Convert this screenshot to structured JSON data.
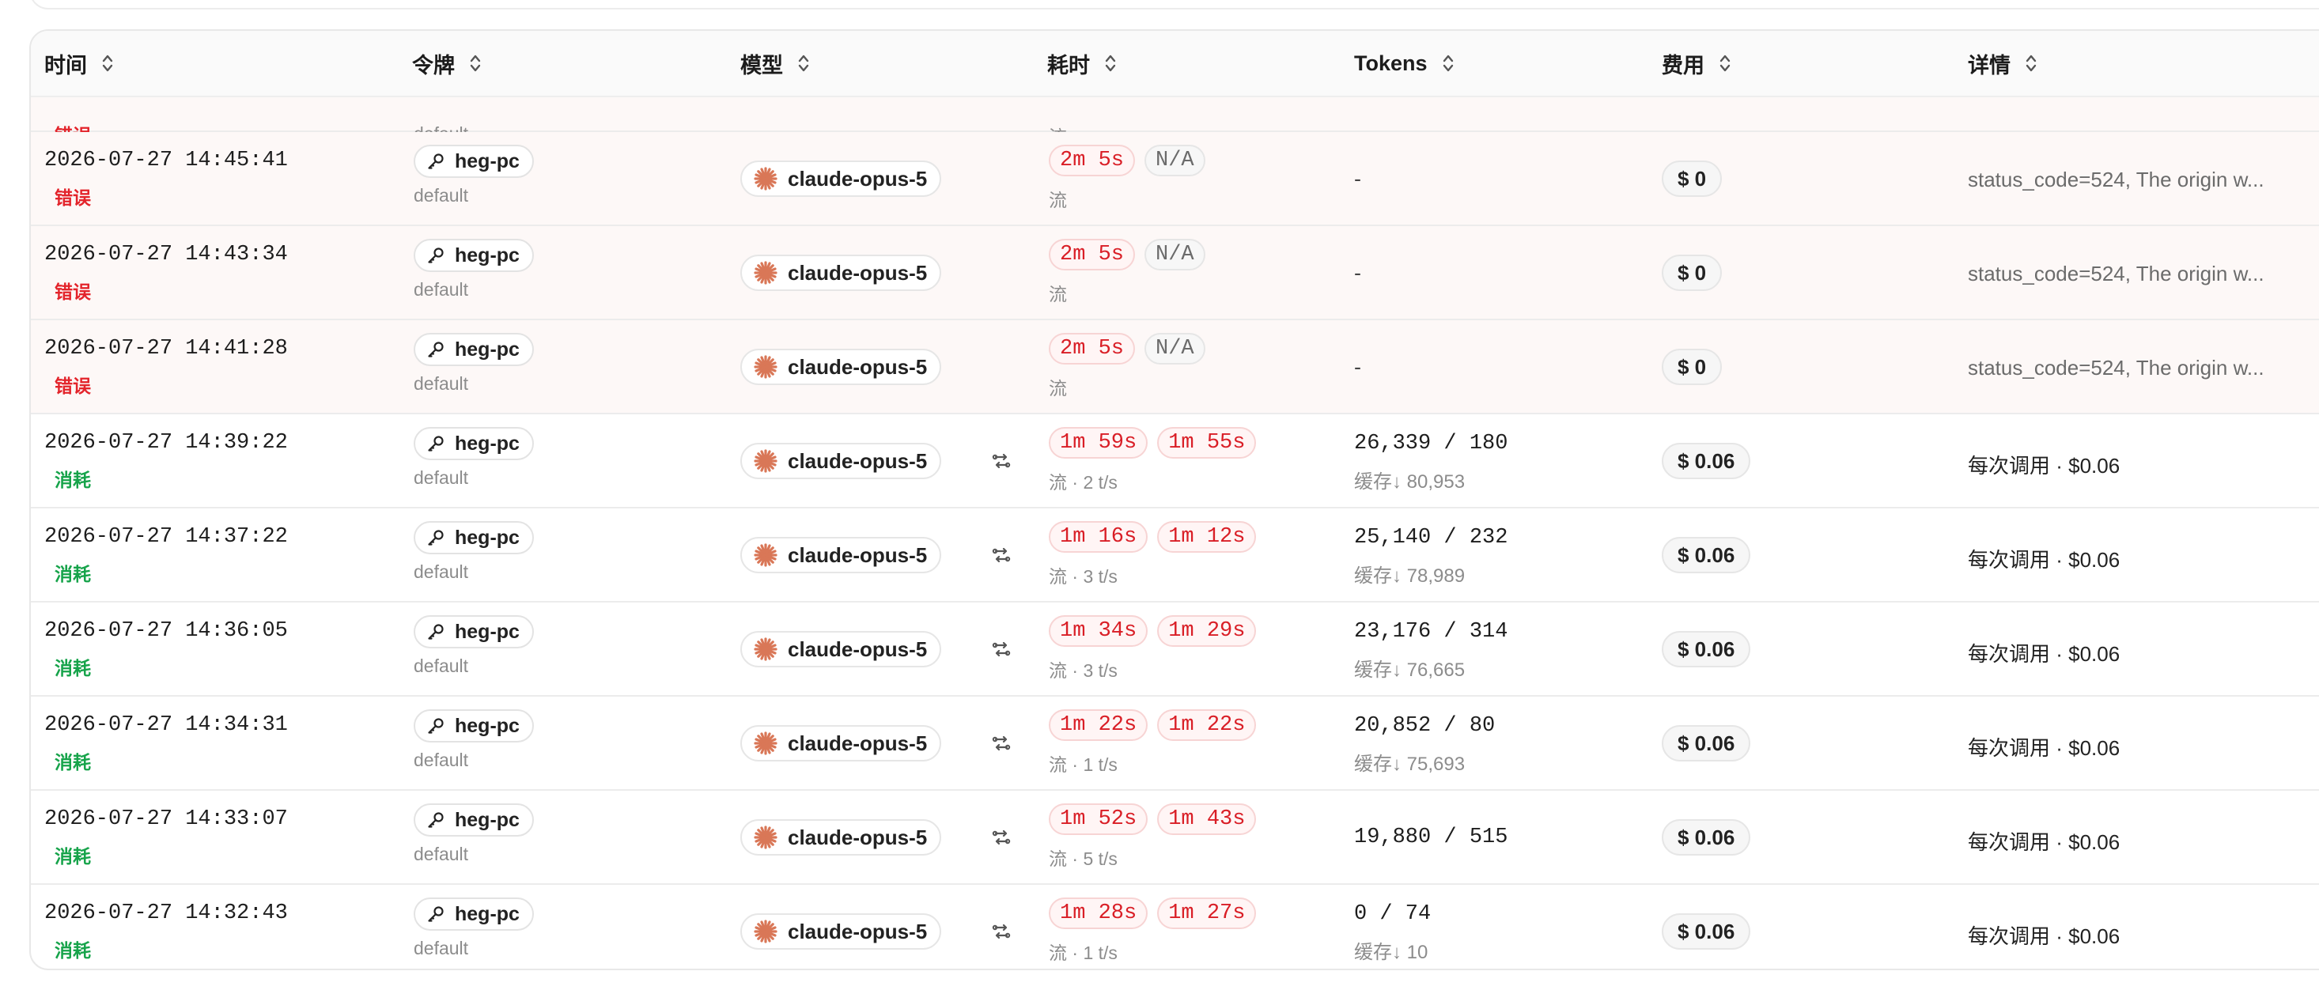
{
  "columns": {
    "time": "时间",
    "token": "令牌",
    "model": "模型",
    "duration": "耗时",
    "tokens": "Tokens",
    "cost": "费用",
    "detail": "详情"
  },
  "colors": {
    "error": "#e3242b",
    "consume": "#16a34a",
    "duration_red": "#d91e26",
    "claude_orange": "#d97757"
  },
  "icons": {
    "sort": "sort-icon",
    "key": "key-icon",
    "model": "claude-logo-icon",
    "route": "route-icon"
  },
  "partial_row": {
    "status": "错误",
    "group": "default",
    "stream": "流"
  },
  "rows": [
    {
      "time": "2026-07-27 14:45:41",
      "status": "错误",
      "type": "error",
      "token": "heg-pc",
      "group": "default",
      "model": "claude-opus-5",
      "duration": "2m 5s",
      "first_token": "N/A",
      "stream": "流",
      "tokens": "-",
      "cache": "",
      "cost": "$ 0",
      "detail": "status_code=524, The origin w..."
    },
    {
      "time": "2026-07-27 14:43:34",
      "status": "错误",
      "type": "error",
      "token": "heg-pc",
      "group": "default",
      "model": "claude-opus-5",
      "duration": "2m 5s",
      "first_token": "N/A",
      "stream": "流",
      "tokens": "-",
      "cache": "",
      "cost": "$ 0",
      "detail": "status_code=524, The origin w..."
    },
    {
      "time": "2026-07-27 14:41:28",
      "status": "错误",
      "type": "error",
      "token": "heg-pc",
      "group": "default",
      "model": "claude-opus-5",
      "duration": "2m 5s",
      "first_token": "N/A",
      "stream": "流",
      "tokens": "-",
      "cache": "",
      "cost": "$ 0",
      "detail": "status_code=524, The origin w..."
    },
    {
      "time": "2026-07-27 14:39:22",
      "status": "消耗",
      "type": "consume",
      "token": "heg-pc",
      "group": "default",
      "model": "claude-opus-5",
      "duration": "1m 59s",
      "first_token": "1m 55s",
      "stream": "流 · 2 t/s",
      "tokens": "26,339 / 180",
      "cache": "缓存↓ 80,953",
      "cost": "$ 0.06",
      "detail": "每次调用 · $0.06"
    },
    {
      "time": "2026-07-27 14:37:22",
      "status": "消耗",
      "type": "consume",
      "token": "heg-pc",
      "group": "default",
      "model": "claude-opus-5",
      "duration": "1m 16s",
      "first_token": "1m 12s",
      "stream": "流 · 3 t/s",
      "tokens": "25,140 / 232",
      "cache": "缓存↓ 78,989",
      "cost": "$ 0.06",
      "detail": "每次调用 · $0.06"
    },
    {
      "time": "2026-07-27 14:36:05",
      "status": "消耗",
      "type": "consume",
      "token": "heg-pc",
      "group": "default",
      "model": "claude-opus-5",
      "duration": "1m 34s",
      "first_token": "1m 29s",
      "stream": "流 · 3 t/s",
      "tokens": "23,176 / 314",
      "cache": "缓存↓ 76,665",
      "cost": "$ 0.06",
      "detail": "每次调用 · $0.06"
    },
    {
      "time": "2026-07-27 14:34:31",
      "status": "消耗",
      "type": "consume",
      "token": "heg-pc",
      "group": "default",
      "model": "claude-opus-5",
      "duration": "1m 22s",
      "first_token": "1m 22s",
      "stream": "流 · 1 t/s",
      "tokens": "20,852 / 80",
      "cache": "缓存↓ 75,693",
      "cost": "$ 0.06",
      "detail": "每次调用 · $0.06"
    },
    {
      "time": "2026-07-27 14:33:07",
      "status": "消耗",
      "type": "consume",
      "token": "heg-pc",
      "group": "default",
      "model": "claude-opus-5",
      "duration": "1m 52s",
      "first_token": "1m 43s",
      "stream": "流 · 5 t/s",
      "tokens": "19,880 / 515",
      "cache": "",
      "cost": "$ 0.06",
      "detail": "每次调用 · $0.06"
    },
    {
      "time": "2026-07-27 14:32:43",
      "status": "消耗",
      "type": "consume",
      "token": "heg-pc",
      "group": "default",
      "model": "claude-opus-5",
      "duration": "1m 28s",
      "first_token": "1m 27s",
      "stream": "流 · 1 t/s",
      "tokens": "0 / 74",
      "cache": "缓存↓ 10",
      "cost": "$ 0.06",
      "detail": "每次调用 · $0.06"
    }
  ]
}
